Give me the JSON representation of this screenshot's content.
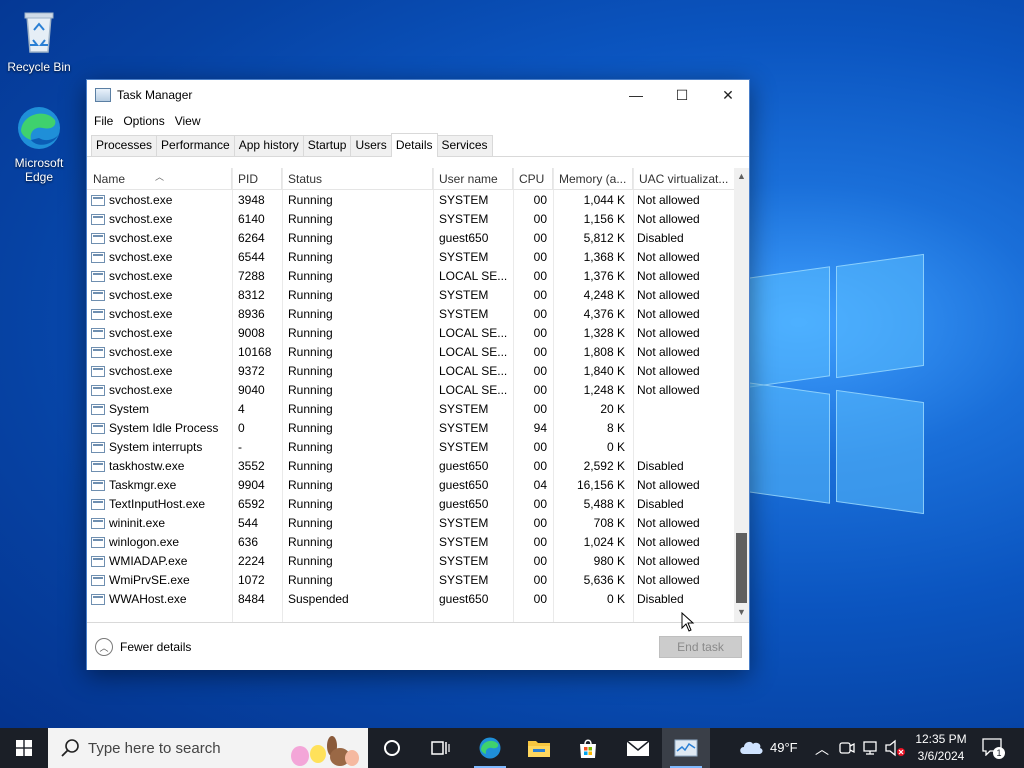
{
  "desktop": {
    "icons": [
      {
        "label": "Recycle Bin",
        "icon": "recycle-bin-icon"
      },
      {
        "label": "Microsoft Edge",
        "icon": "edge-icon"
      }
    ]
  },
  "window": {
    "title": "Task Manager",
    "controls": {
      "minimize": "—",
      "maximize": "☐",
      "close": "✕"
    },
    "menu": [
      "File",
      "Options",
      "View"
    ],
    "tabs": [
      "Processes",
      "Performance",
      "App history",
      "Startup",
      "Users",
      "Details",
      "Services"
    ],
    "active_tab": "Details",
    "columns": [
      "Name",
      "PID",
      "Status",
      "User name",
      "CPU",
      "Memory (a...",
      "UAC virtualizat..."
    ],
    "rows": [
      {
        "name": "svchost.exe",
        "pid": "3948",
        "status": "Running",
        "user": "SYSTEM",
        "cpu": "00",
        "mem": "1,044 K",
        "uac": "Not allowed"
      },
      {
        "name": "svchost.exe",
        "pid": "6140",
        "status": "Running",
        "user": "SYSTEM",
        "cpu": "00",
        "mem": "1,156 K",
        "uac": "Not allowed"
      },
      {
        "name": "svchost.exe",
        "pid": "6264",
        "status": "Running",
        "user": "guest650",
        "cpu": "00",
        "mem": "5,812 K",
        "uac": "Disabled"
      },
      {
        "name": "svchost.exe",
        "pid": "6544",
        "status": "Running",
        "user": "SYSTEM",
        "cpu": "00",
        "mem": "1,368 K",
        "uac": "Not allowed"
      },
      {
        "name": "svchost.exe",
        "pid": "7288",
        "status": "Running",
        "user": "LOCAL SE...",
        "cpu": "00",
        "mem": "1,376 K",
        "uac": "Not allowed"
      },
      {
        "name": "svchost.exe",
        "pid": "8312",
        "status": "Running",
        "user": "SYSTEM",
        "cpu": "00",
        "mem": "4,248 K",
        "uac": "Not allowed"
      },
      {
        "name": "svchost.exe",
        "pid": "8936",
        "status": "Running",
        "user": "SYSTEM",
        "cpu": "00",
        "mem": "4,376 K",
        "uac": "Not allowed"
      },
      {
        "name": "svchost.exe",
        "pid": "9008",
        "status": "Running",
        "user": "LOCAL SE...",
        "cpu": "00",
        "mem": "1,328 K",
        "uac": "Not allowed"
      },
      {
        "name": "svchost.exe",
        "pid": "10168",
        "status": "Running",
        "user": "LOCAL SE...",
        "cpu": "00",
        "mem": "1,808 K",
        "uac": "Not allowed"
      },
      {
        "name": "svchost.exe",
        "pid": "9372",
        "status": "Running",
        "user": "LOCAL SE...",
        "cpu": "00",
        "mem": "1,840 K",
        "uac": "Not allowed"
      },
      {
        "name": "svchost.exe",
        "pid": "9040",
        "status": "Running",
        "user": "LOCAL SE...",
        "cpu": "00",
        "mem": "1,248 K",
        "uac": "Not allowed"
      },
      {
        "name": "System",
        "pid": "4",
        "status": "Running",
        "user": "SYSTEM",
        "cpu": "00",
        "mem": "20 K",
        "uac": ""
      },
      {
        "name": "System Idle Process",
        "pid": "0",
        "status": "Running",
        "user": "SYSTEM",
        "cpu": "94",
        "mem": "8 K",
        "uac": ""
      },
      {
        "name": "System interrupts",
        "pid": "-",
        "status": "Running",
        "user": "SYSTEM",
        "cpu": "00",
        "mem": "0 K",
        "uac": ""
      },
      {
        "name": "taskhostw.exe",
        "pid": "3552",
        "status": "Running",
        "user": "guest650",
        "cpu": "00",
        "mem": "2,592 K",
        "uac": "Disabled"
      },
      {
        "name": "Taskmgr.exe",
        "pid": "9904",
        "status": "Running",
        "user": "guest650",
        "cpu": "04",
        "mem": "16,156 K",
        "uac": "Not allowed"
      },
      {
        "name": "TextInputHost.exe",
        "pid": "6592",
        "status": "Running",
        "user": "guest650",
        "cpu": "00",
        "mem": "5,488 K",
        "uac": "Disabled"
      },
      {
        "name": "wininit.exe",
        "pid": "544",
        "status": "Running",
        "user": "SYSTEM",
        "cpu": "00",
        "mem": "708 K",
        "uac": "Not allowed"
      },
      {
        "name": "winlogon.exe",
        "pid": "636",
        "status": "Running",
        "user": "SYSTEM",
        "cpu": "00",
        "mem": "1,024 K",
        "uac": "Not allowed"
      },
      {
        "name": "WMIADAP.exe",
        "pid": "2224",
        "status": "Running",
        "user": "SYSTEM",
        "cpu": "00",
        "mem": "980 K",
        "uac": "Not allowed"
      },
      {
        "name": "WmiPrvSE.exe",
        "pid": "1072",
        "status": "Running",
        "user": "SYSTEM",
        "cpu": "00",
        "mem": "5,636 K",
        "uac": "Not allowed"
      },
      {
        "name": "WWAHost.exe",
        "pid": "8484",
        "status": "Suspended",
        "user": "guest650",
        "cpu": "00",
        "mem": "0 K",
        "uac": "Disabled"
      }
    ],
    "footer": {
      "fewer_details": "Fewer details",
      "end_task": "End task"
    }
  },
  "taskbar": {
    "search_placeholder": "Type here to search",
    "pinned": [
      "task-view-icon",
      "edge-icon",
      "file-explorer-icon",
      "microsoft-store-icon",
      "mail-icon",
      "task-manager-icon"
    ],
    "weather": "49°F",
    "time": "12:35 PM",
    "date": "3/6/2024",
    "notification_count": "1"
  }
}
